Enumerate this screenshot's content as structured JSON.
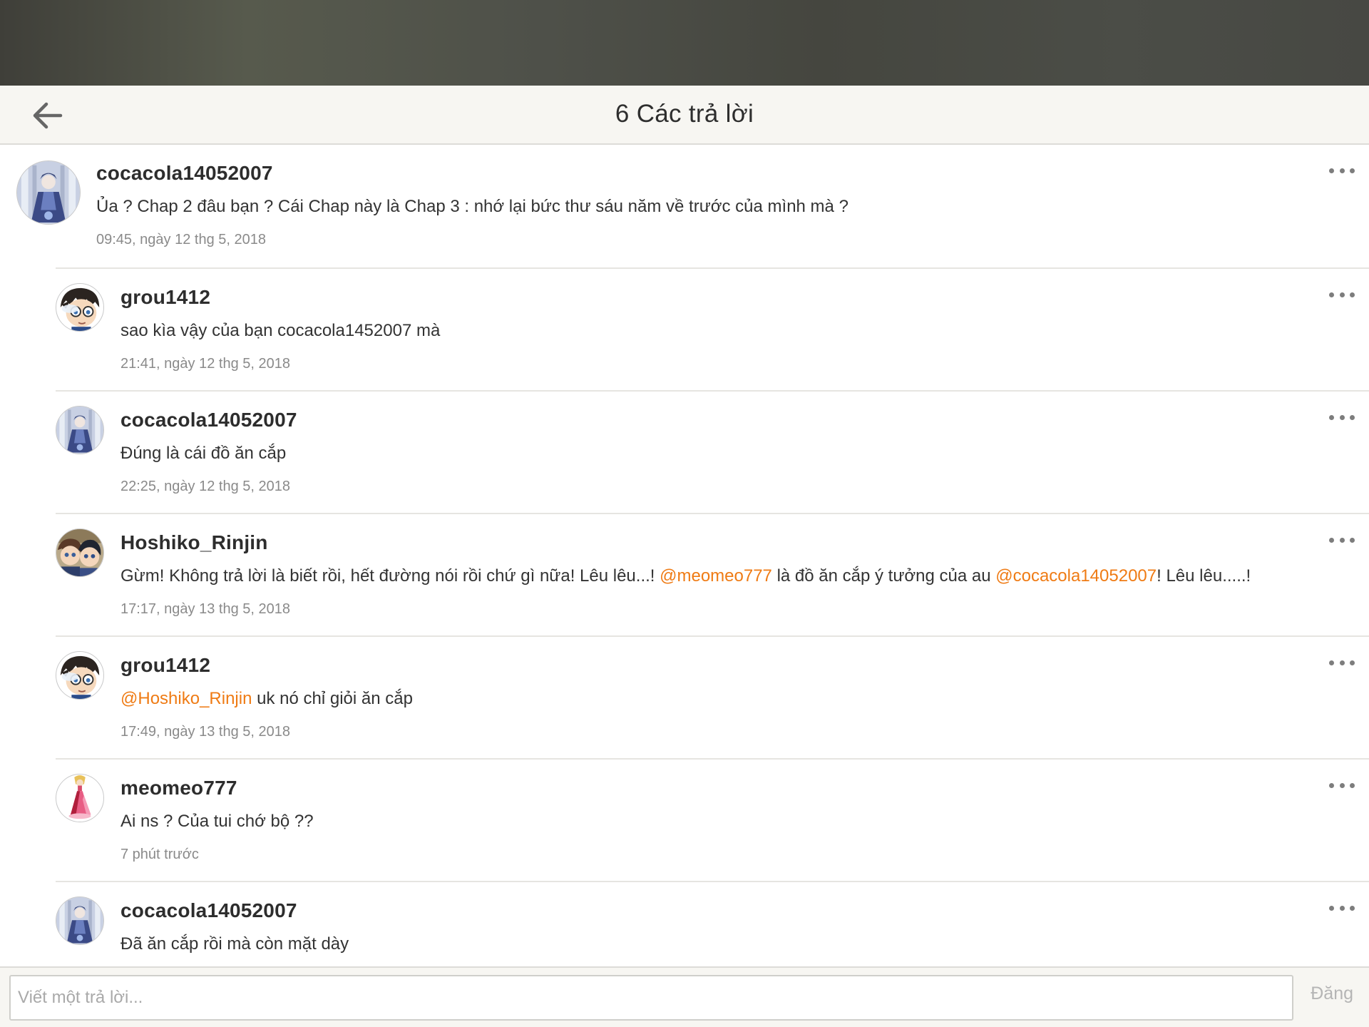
{
  "header": {
    "title": "6 Các trả lời",
    "back_icon": "arrow-left-icon"
  },
  "comments": [
    {
      "username": "cocacola14052007",
      "avatar": "avatar-character-blue",
      "text_parts": [
        {
          "text": "Ủa ? Chap 2 đâu bạn ? Cái Chap này là Chap 3 : nhớ lại bức thư sáu năm về trước của mình mà ?",
          "mention": false
        }
      ],
      "timestamp": "09:45, ngày 12 thg 5, 2018"
    },
    {
      "username": "grou1412",
      "avatar": "avatar-anime-boy-glasses",
      "text_parts": [
        {
          "text": "sao kìa vậy của bạn cocacola1452007 mà",
          "mention": false
        }
      ],
      "timestamp": "21:41, ngày 12 thg 5, 2018"
    },
    {
      "username": "cocacola14052007",
      "avatar": "avatar-character-blue",
      "text_parts": [
        {
          "text": "Đúng là cái đồ ăn cắp",
          "mention": false
        }
      ],
      "timestamp": "22:25, ngày 12 thg 5, 2018"
    },
    {
      "username": "Hoshiko_Rinjin",
      "avatar": "avatar-anime-couple",
      "text_parts": [
        {
          "text": "Gừm! Không trả lời là biết rồi, hết đường nói rồi chứ gì nữa! Lêu lêu...! ",
          "mention": false
        },
        {
          "text": "@meomeo777",
          "mention": true
        },
        {
          "text": " là đồ ăn cắp ý tưởng của au ",
          "mention": false
        },
        {
          "text": "@cocacola14052007",
          "mention": true
        },
        {
          "text": "! Lêu lêu.....!",
          "mention": false
        }
      ],
      "timestamp": "17:17, ngày 13 thg 5, 2018"
    },
    {
      "username": "grou1412",
      "avatar": "avatar-anime-boy-glasses",
      "text_parts": [
        {
          "text": "@Hoshiko_Rinjin",
          "mention": true
        },
        {
          "text": " uk nó chỉ giỏi ăn cắp",
          "mention": false
        }
      ],
      "timestamp": "17:49, ngày 13 thg 5, 2018"
    },
    {
      "username": "meomeo777",
      "avatar": "avatar-princess-pink-dress",
      "text_parts": [
        {
          "text": "Ai ns ? Của tui chớ bộ ??",
          "mention": false
        }
      ],
      "timestamp": "7 phút trước"
    },
    {
      "username": "cocacola14052007",
      "avatar": "avatar-character-blue",
      "text_parts": [
        {
          "text": "Đã ăn cắp rồi mà còn mặt dày",
          "mention": false
        }
      ],
      "timestamp": ""
    }
  ],
  "composer": {
    "placeholder": "Viết một trả lời...",
    "post_label": "Đăng"
  },
  "colors": {
    "mention": "#ef7b14",
    "header_bg": "#f7f6f2",
    "divider": "#e6e5e1",
    "timestamp": "#8a8a8a"
  }
}
